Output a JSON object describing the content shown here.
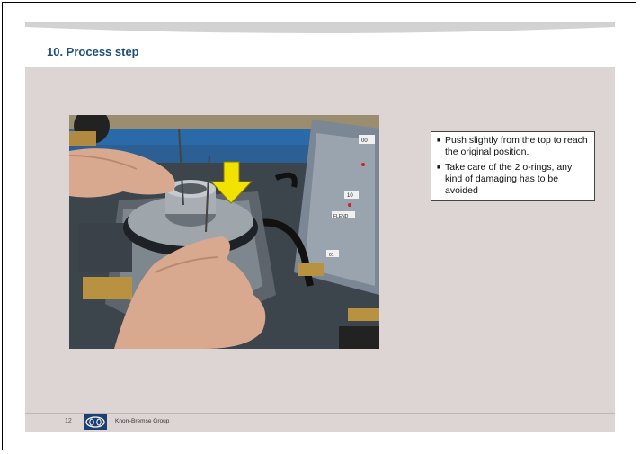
{
  "slide": {
    "title": "10. Process step",
    "notes": [
      "Push slightly from the top to reach the original position.",
      "Take care of the 2 o-rings, any kind of damaging has to be avoided"
    ],
    "footer": {
      "page_number": "12",
      "company": "Knorr-Bremse Group"
    }
  },
  "photo": {
    "labels": [
      "00",
      "10",
      "FLEND",
      "01"
    ]
  },
  "colors": {
    "title": "#1d4f7a",
    "content_background": "#dcd5d3",
    "arrow": "#f2e200",
    "logo": "#1e3f73"
  }
}
